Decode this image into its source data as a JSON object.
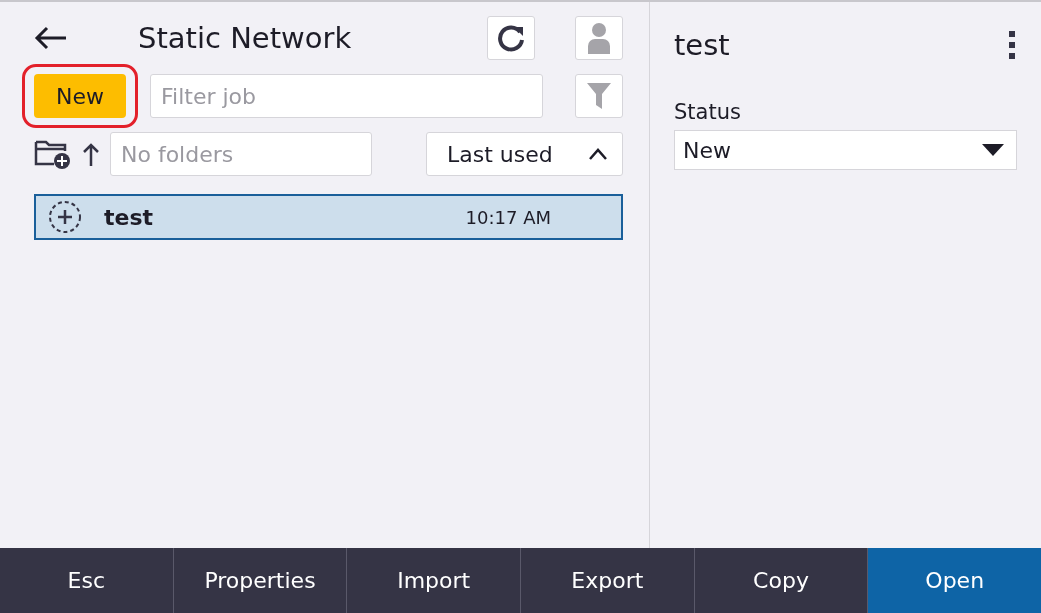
{
  "header": {
    "title": "Static Network"
  },
  "new_button": {
    "label": "New",
    "highlighted": true
  },
  "filter": {
    "placeholder": "Filter job"
  },
  "folder": {
    "placeholder": "No folders"
  },
  "sort": {
    "label": "Last used",
    "ascending": true
  },
  "jobs": [
    {
      "name": "test",
      "time": "10:17 AM",
      "selected": true
    }
  ],
  "detail": {
    "title": "test",
    "status_label": "Status",
    "status_value": "New"
  },
  "footer": [
    {
      "label": "Esc",
      "primary": false
    },
    {
      "label": "Properties",
      "primary": false
    },
    {
      "label": "Import",
      "primary": false
    },
    {
      "label": "Export",
      "primary": false
    },
    {
      "label": "Copy",
      "primary": false
    },
    {
      "label": "Open",
      "primary": true
    }
  ]
}
